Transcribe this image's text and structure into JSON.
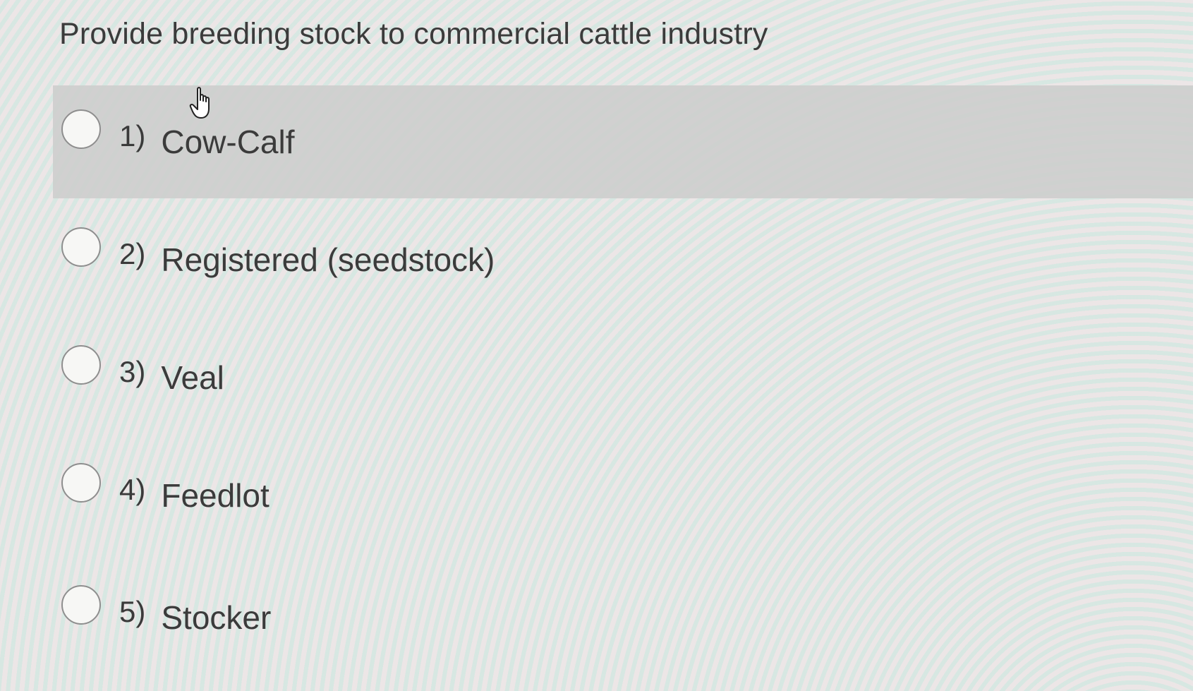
{
  "question": {
    "text": "Provide breeding stock to commercial cattle industry"
  },
  "options": [
    {
      "number": "1)",
      "label": "Cow-Calf",
      "selected": false,
      "hovered": true
    },
    {
      "number": "2)",
      "label": "Registered (seedstock)",
      "selected": false,
      "hovered": false
    },
    {
      "number": "3)",
      "label": "Veal",
      "selected": false,
      "hovered": false
    },
    {
      "number": "4)",
      "label": "Feedlot",
      "selected": false,
      "hovered": false
    },
    {
      "number": "5)",
      "label": "Stocker",
      "selected": false,
      "hovered": false
    }
  ],
  "colors": {
    "hover_background": "#cdcdcb",
    "text": "#3b3b3b",
    "radio_border": "#8e8e8e"
  },
  "icons": {
    "pointer": "hand-pointer-icon",
    "radio": "radio-circle-icon"
  }
}
